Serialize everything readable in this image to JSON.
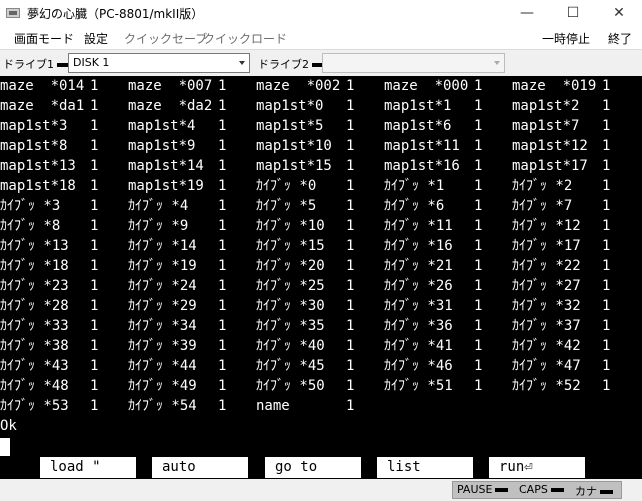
{
  "window": {
    "title": "夢幻の心臓（PC-8801/mkII版）",
    "minimize": "—",
    "maximize": "☐",
    "close": "✕"
  },
  "menu": {
    "left": [
      "画面モード",
      "設定",
      "クイックセーブ",
      "クイックロード"
    ],
    "right": [
      "一時停止",
      "終了"
    ]
  },
  "toolbar": {
    "drive1_label": "ドライブ1",
    "drive1_value": "DISK 1",
    "drive2_label": "ドライブ2",
    "drive2_value": ""
  },
  "screen": {
    "rows": [
      [
        "maze  *014",
        "1",
        "maze  *007",
        "1",
        "maze  *002",
        "1",
        "maze  *000",
        "1",
        "maze  *019",
        "1"
      ],
      [
        "maze  *da1",
        "1",
        "maze  *da2",
        "1",
        "map1st*0",
        "1",
        "map1st*1",
        "1",
        "map1st*2",
        "1"
      ],
      [
        "map1st*3",
        "1",
        "map1st*4",
        "1",
        "map1st*5",
        "1",
        "map1st*6",
        "1",
        "map1st*7",
        "1"
      ],
      [
        "map1st*8",
        "1",
        "map1st*9",
        "1",
        "map1st*10",
        "1",
        "map1st*11",
        "1",
        "map1st*12",
        "1"
      ],
      [
        "map1st*13",
        "1",
        "map1st*14",
        "1",
        "map1st*15",
        "1",
        "map1st*16",
        "1",
        "map1st*17",
        "1"
      ],
      [
        "map1st*18",
        "1",
        "map1st*19",
        "1",
        "ｶｲﾌﾞｯ *0",
        "1",
        "ｶｲﾌﾞｯ *1",
        "1",
        "ｶｲﾌﾞｯ *2",
        "1"
      ],
      [
        "ｶｲﾌﾞｯ *3",
        "1",
        "ｶｲﾌﾞｯ *4",
        "1",
        "ｶｲﾌﾞｯ *5",
        "1",
        "ｶｲﾌﾞｯ *6",
        "1",
        "ｶｲﾌﾞｯ *7",
        "1"
      ],
      [
        "ｶｲﾌﾞｯ *8",
        "1",
        "ｶｲﾌﾞｯ *9",
        "1",
        "ｶｲﾌﾞｯ *10",
        "1",
        "ｶｲﾌﾞｯ *11",
        "1",
        "ｶｲﾌﾞｯ *12",
        "1"
      ],
      [
        "ｶｲﾌﾞｯ *13",
        "1",
        "ｶｲﾌﾞｯ *14",
        "1",
        "ｶｲﾌﾞｯ *15",
        "1",
        "ｶｲﾌﾞｯ *16",
        "1",
        "ｶｲﾌﾞｯ *17",
        "1"
      ],
      [
        "ｶｲﾌﾞｯ *18",
        "1",
        "ｶｲﾌﾞｯ *19",
        "1",
        "ｶｲﾌﾞｯ *20",
        "1",
        "ｶｲﾌﾞｯ *21",
        "1",
        "ｶｲﾌﾞｯ *22",
        "1"
      ],
      [
        "ｶｲﾌﾞｯ *23",
        "1",
        "ｶｲﾌﾞｯ *24",
        "1",
        "ｶｲﾌﾞｯ *25",
        "1",
        "ｶｲﾌﾞｯ *26",
        "1",
        "ｶｲﾌﾞｯ *27",
        "1"
      ],
      [
        "ｶｲﾌﾞｯ *28",
        "1",
        "ｶｲﾌﾞｯ *29",
        "1",
        "ｶｲﾌﾞｯ *30",
        "1",
        "ｶｲﾌﾞｯ *31",
        "1",
        "ｶｲﾌﾞｯ *32",
        "1"
      ],
      [
        "ｶｲﾌﾞｯ *33",
        "1",
        "ｶｲﾌﾞｯ *34",
        "1",
        "ｶｲﾌﾞｯ *35",
        "1",
        "ｶｲﾌﾞｯ *36",
        "1",
        "ｶｲﾌﾞｯ *37",
        "1"
      ],
      [
        "ｶｲﾌﾞｯ *38",
        "1",
        "ｶｲﾌﾞｯ *39",
        "1",
        "ｶｲﾌﾞｯ *40",
        "1",
        "ｶｲﾌﾞｯ *41",
        "1",
        "ｶｲﾌﾞｯ *42",
        "1"
      ],
      [
        "ｶｲﾌﾞｯ *43",
        "1",
        "ｶｲﾌﾞｯ *44",
        "1",
        "ｶｲﾌﾞｯ *45",
        "1",
        "ｶｲﾌﾞｯ *46",
        "1",
        "ｶｲﾌﾞｯ *47",
        "1"
      ],
      [
        "ｶｲﾌﾞｯ *48",
        "1",
        "ｶｲﾌﾞｯ *49",
        "1",
        "ｶｲﾌﾞｯ *50",
        "1",
        "ｶｲﾌﾞｯ *51",
        "1",
        "ｶｲﾌﾞｯ *52",
        "1"
      ],
      [
        "ｶｲﾌﾞｯ *53",
        "1",
        "ｶｲﾌﾞｯ *54",
        "1",
        "name",
        "1"
      ],
      [
        "Ok"
      ]
    ],
    "function_keys": [
      "load \"",
      "auto",
      "go to",
      "list",
      "run⏎"
    ]
  },
  "status": [
    "PAUSE",
    "CAPS",
    "カナ"
  ]
}
